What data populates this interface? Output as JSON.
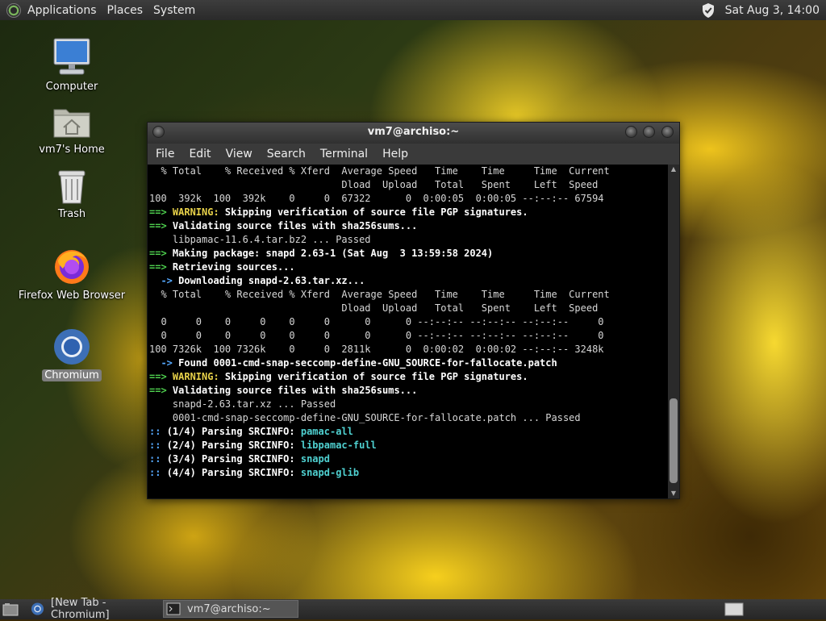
{
  "top_panel": {
    "menus": [
      "Applications",
      "Places",
      "System"
    ],
    "clock": "Sat Aug  3, 14:00",
    "icons": {
      "logo": "distro-logo-icon",
      "shield": "shield-check-icon"
    }
  },
  "desktop": {
    "icons": [
      {
        "label": "Computer",
        "icon": "computer-monitor-icon"
      },
      {
        "label": "vm7's Home",
        "icon": "home-folder-icon"
      },
      {
        "label": "Trash",
        "icon": "trash-icon"
      },
      {
        "label": "Firefox Web Browser",
        "icon": "firefox-icon"
      },
      {
        "label": "Chromium",
        "icon": "chromium-icon",
        "selected": true
      }
    ]
  },
  "terminal": {
    "title": "vm7@archiso:~",
    "menu": [
      "File",
      "Edit",
      "View",
      "Search",
      "Terminal",
      "Help"
    ],
    "lines": [
      [
        {
          "t": "  % Total    % Received % Xferd  Average Speed   Time    Time     Time  Current"
        }
      ],
      [
        {
          "t": "                                 Dload  Upload   Total   Spent    Left  Speed"
        }
      ],
      [
        {
          "t": "100  392k  100  392k    0     0  67322      0  0:00:05  0:00:05 --:--:-- 67594"
        }
      ],
      [
        {
          "t": "==> ",
          "s": "g"
        },
        {
          "t": "WARNING:",
          "s": "y"
        },
        {
          "t": " Skipping verification of source file PGP signatures.",
          "s": "b"
        }
      ],
      [
        {
          "t": "==> ",
          "s": "g"
        },
        {
          "t": "Validating source files with sha256sums...",
          "s": "b"
        }
      ],
      [
        {
          "t": "    libpamac-11.6.4.tar.bz2 ... Passed"
        }
      ],
      [
        {
          "t": "==> ",
          "s": "g"
        },
        {
          "t": "Making package: snapd 2.63-1 (Sat Aug  3 13:59:58 2024)",
          "s": "b"
        }
      ],
      [
        {
          "t": "==> ",
          "s": "g"
        },
        {
          "t": "Retrieving sources...",
          "s": "b"
        }
      ],
      [
        {
          "t": "  -> ",
          "s": "bl"
        },
        {
          "t": "Downloading snapd-2.63.tar.xz...",
          "s": "b"
        }
      ],
      [
        {
          "t": "  % Total    % Received % Xferd  Average Speed   Time    Time     Time  Current"
        }
      ],
      [
        {
          "t": "                                 Dload  Upload   Total   Spent    Left  Speed"
        }
      ],
      [
        {
          "t": "  0     0    0     0    0     0      0      0 --:--:-- --:--:-- --:--:--     0"
        }
      ],
      [
        {
          "t": "  0     0    0     0    0     0      0      0 --:--:-- --:--:-- --:--:--     0"
        }
      ],
      [
        {
          "t": "100 7326k  100 7326k    0     0  2811k      0  0:00:02  0:00:02 --:--:-- 3248k"
        }
      ],
      [
        {
          "t": "  -> ",
          "s": "bl"
        },
        {
          "t": "Found 0001-cmd-snap-seccomp-define-GNU_SOURCE-for-fallocate.patch",
          "s": "b"
        }
      ],
      [
        {
          "t": "==> ",
          "s": "g"
        },
        {
          "t": "WARNING:",
          "s": "y"
        },
        {
          "t": " Skipping verification of source file PGP signatures.",
          "s": "b"
        }
      ],
      [
        {
          "t": "==> ",
          "s": "g"
        },
        {
          "t": "Validating source files with sha256sums...",
          "s": "b"
        }
      ],
      [
        {
          "t": "    snapd-2.63.tar.xz ... Passed"
        }
      ],
      [
        {
          "t": "    0001-cmd-snap-seccomp-define-GNU_SOURCE-for-fallocate.patch ... Passed"
        }
      ],
      [
        {
          "t": ":: ",
          "s": "bl"
        },
        {
          "t": "(1/4) Parsing SRCINFO: ",
          "s": "b"
        },
        {
          "t": "pamac-all",
          "s": "c"
        }
      ],
      [
        {
          "t": ":: ",
          "s": "bl"
        },
        {
          "t": "(2/4) Parsing SRCINFO: ",
          "s": "b"
        },
        {
          "t": "libpamac-full",
          "s": "c"
        }
      ],
      [
        {
          "t": ":: ",
          "s": "bl"
        },
        {
          "t": "(3/4) Parsing SRCINFO: ",
          "s": "b"
        },
        {
          "t": "snapd",
          "s": "c"
        }
      ],
      [
        {
          "t": ":: ",
          "s": "bl"
        },
        {
          "t": "(4/4) Parsing SRCINFO: ",
          "s": "b"
        },
        {
          "t": "snapd-glib",
          "s": "c"
        }
      ]
    ]
  },
  "taskbar": {
    "items": [
      {
        "label": "[New Tab - Chromium]",
        "icon": "chromium-icon"
      },
      {
        "label": "vm7@archiso:~",
        "icon": "terminal-icon",
        "active": true
      }
    ],
    "icons": {
      "show_desktop": "show-desktop-icon",
      "workspace": "workspace-switcher-icon"
    }
  }
}
